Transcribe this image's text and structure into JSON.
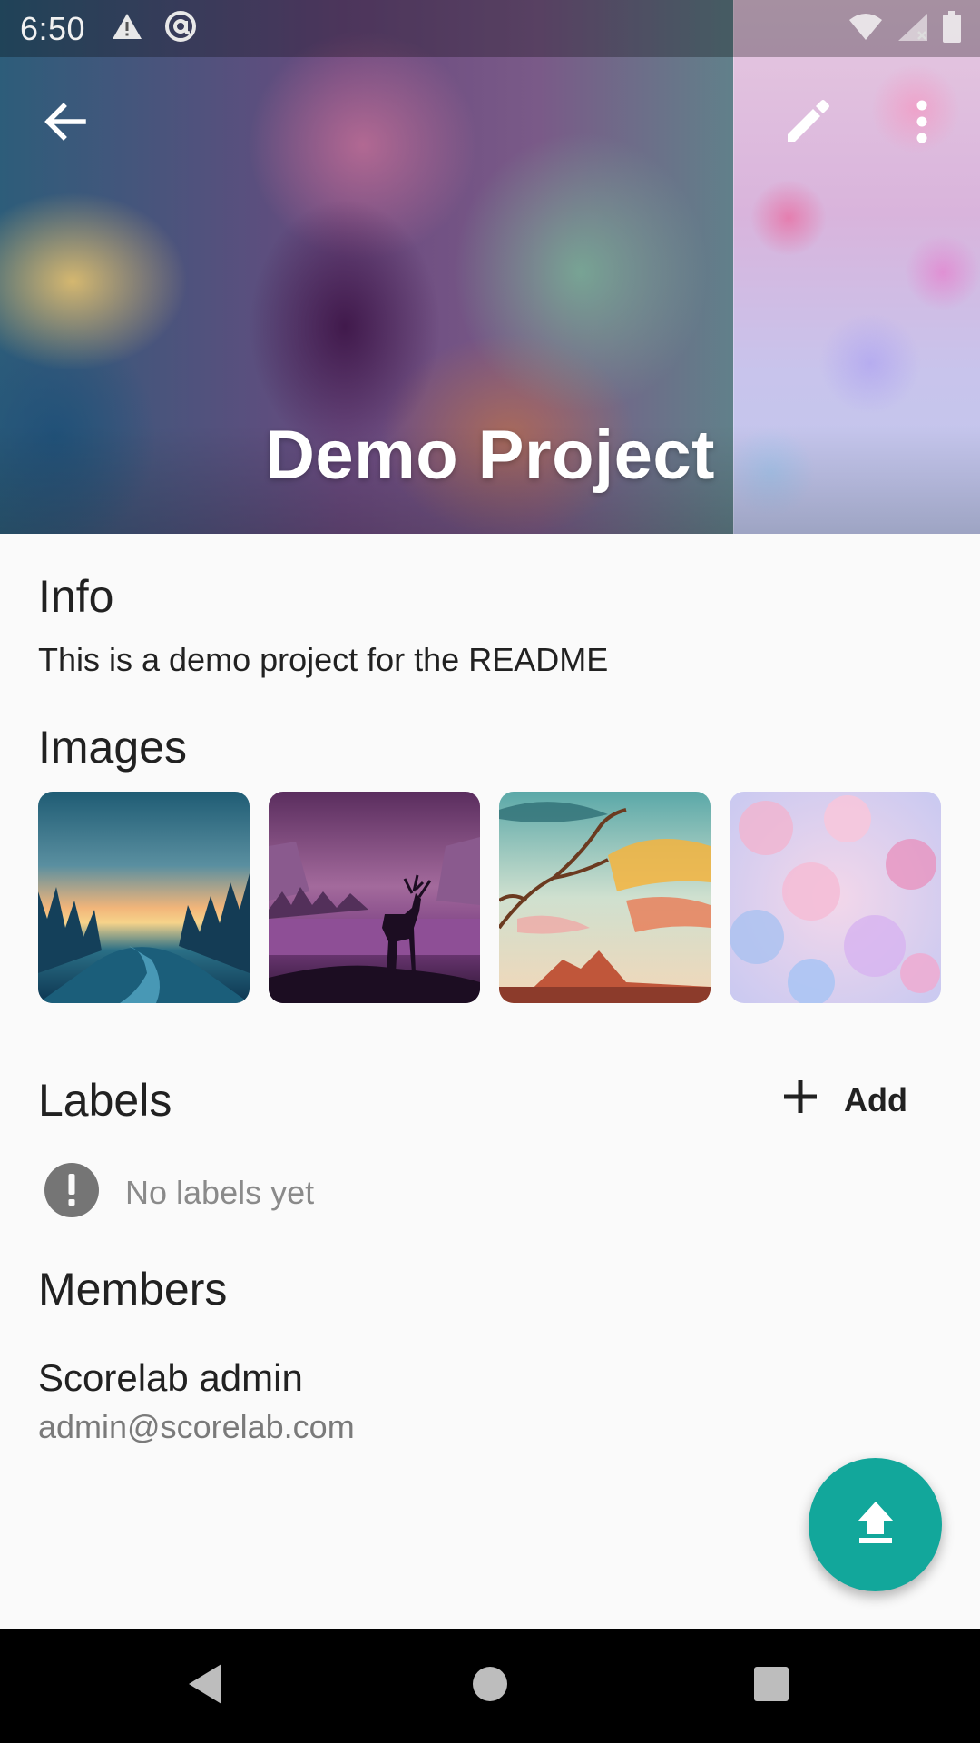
{
  "status_bar": {
    "time": "6:50",
    "left_icons": [
      "warning-icon",
      "at-sign-icon"
    ],
    "right_icons": [
      "wifi-icon",
      "signal-icon",
      "battery-icon"
    ]
  },
  "app_bar": {
    "back_icon": "arrow-back-icon",
    "edit_icon": "pencil-icon",
    "more_icon": "more-vert-icon",
    "title": "Demo Project"
  },
  "info": {
    "heading": "Info",
    "description": "This is a demo project for the README"
  },
  "images": {
    "heading": "Images",
    "thumbnails": [
      "forest-sunset-image",
      "deer-silhouette-image",
      "tree-sky-image",
      "cherry-blossom-image"
    ]
  },
  "labels": {
    "heading": "Labels",
    "add_label": "Add",
    "add_icon": "plus-icon",
    "empty_icon": "error-circle-icon",
    "empty_text": "No labels yet"
  },
  "members": {
    "heading": "Members",
    "list": [
      {
        "name": "Scorelab admin",
        "email": "admin@scorelab.com"
      }
    ]
  },
  "fab": {
    "icon": "upload-icon",
    "color": "#12a79b"
  },
  "nav_bar": {
    "icons": [
      "nav-back-icon",
      "nav-home-icon",
      "nav-recents-icon"
    ]
  }
}
